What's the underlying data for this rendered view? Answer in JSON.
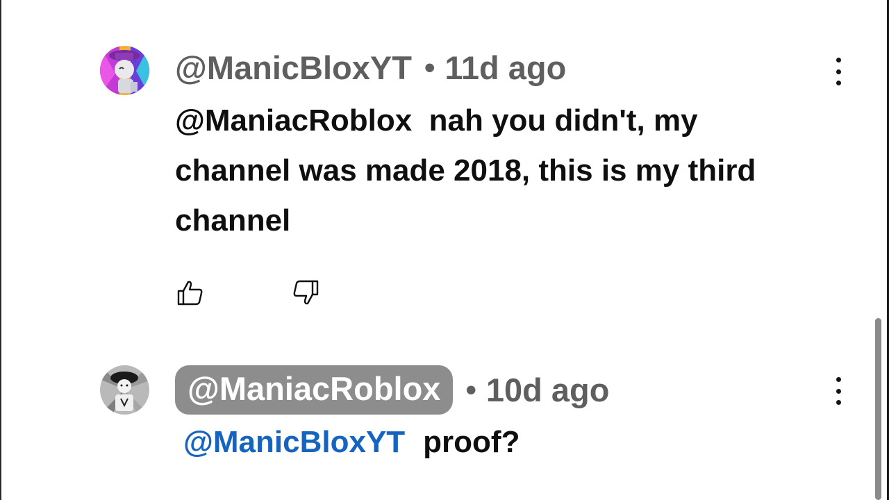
{
  "comments": [
    {
      "author": "@ManicBloxYT",
      "separator": "•",
      "time": "11d ago",
      "text": "@ManiacRoblox  nah you didn't, my\nchannel was made 2018, this is my third\nchannel",
      "avatar_icon": "avatar-purple-robot-icon",
      "accent": "#9b2fb0"
    },
    {
      "author": "@ManiacRoblox",
      "separator": "•",
      "time": "10d ago",
      "mention": "@ManicBloxYT",
      "text": "proof?",
      "avatar_icon": "avatar-dark-figure-icon",
      "mention_color": "#1565c0",
      "author_badge_color": "#8d8d8d"
    }
  ],
  "icons": {
    "more": "more-vertical-icon",
    "like": "thumbs-up-icon",
    "dislike": "thumbs-down-icon"
  }
}
